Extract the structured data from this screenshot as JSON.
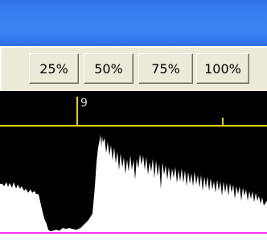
{
  "toolbar": {
    "zoom_buttons": [
      {
        "label": "25%"
      },
      {
        "label": "50%"
      },
      {
        "label": "75%"
      },
      {
        "label": "100%"
      }
    ]
  },
  "timeline": {
    "marker_label": "9"
  },
  "colors": {
    "titlebar": "#3a80f0",
    "toolbar": "#ece9d8",
    "timeline_line": "#e0d000",
    "waveform_background": "#000000",
    "waveform_fill": "#ffffff",
    "baseline": "#ff33ff"
  }
}
